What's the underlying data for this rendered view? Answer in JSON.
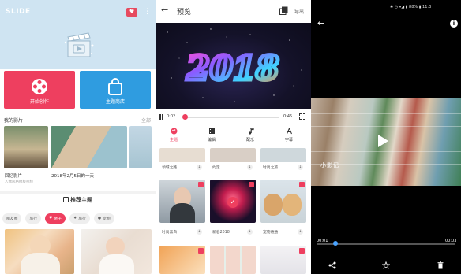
{
  "home": {
    "logo_text": "SLIDE",
    "vip_badge": "♥",
    "more_icon": "⋮",
    "tiles": [
      {
        "label": "开始创作",
        "icon": "film-reel-icon",
        "color": "#ee3f5f"
      },
      {
        "label": "主题商店",
        "icon": "shopping-bag-icon",
        "color": "#2f9ce0"
      }
    ],
    "my_films": {
      "title": "我的影片",
      "more": "全部",
      "items": [
        {
          "title": "回忆影片",
          "subtitle": "人像风格模板视频"
        },
        {
          "title": "2018年2月5日的一天",
          "subtitle": ""
        }
      ]
    },
    "recommend_title": "推荐主题",
    "chips": [
      {
        "label": "朋友圈",
        "active": false
      },
      {
        "label": "旅行",
        "active": false
      },
      {
        "label": "亲子",
        "active": true
      },
      {
        "label": "旅行",
        "active": false
      },
      {
        "label": "宠物",
        "active": false
      }
    ]
  },
  "preview": {
    "back": "←",
    "title": "预览",
    "export": "导出",
    "video_text": "2018",
    "watermark": "小影记",
    "time_current": "0:02",
    "time_total": "0:45",
    "progress": 0.02,
    "tabs": [
      {
        "label": "主题",
        "icon": "palette-icon",
        "active": true
      },
      {
        "label": "编辑",
        "icon": "film-icon",
        "active": false
      },
      {
        "label": "配乐",
        "icon": "music-note-icon",
        "active": false
      },
      {
        "label": "字幕",
        "icon": "text-icon",
        "active": false
      }
    ],
    "top_row": [
      "领域之路",
      "约定",
      "时尚之旅"
    ],
    "themes": [
      {
        "name": "时尚黑白",
        "locked": true
      },
      {
        "name": "新春2018",
        "locked": true,
        "selected": true
      },
      {
        "name": "宠物通通",
        "locked": true
      }
    ]
  },
  "player": {
    "status_text": "✱ ◷ ▾◢ ▮ 88% ▮ 11:3",
    "back": "←",
    "info": "i",
    "watermark": "小影记",
    "time_current": "00:01",
    "time_total": "00:03",
    "progress": 0.12,
    "bottom_icons": [
      "share-icon",
      "star-icon",
      "trash-icon"
    ]
  }
}
